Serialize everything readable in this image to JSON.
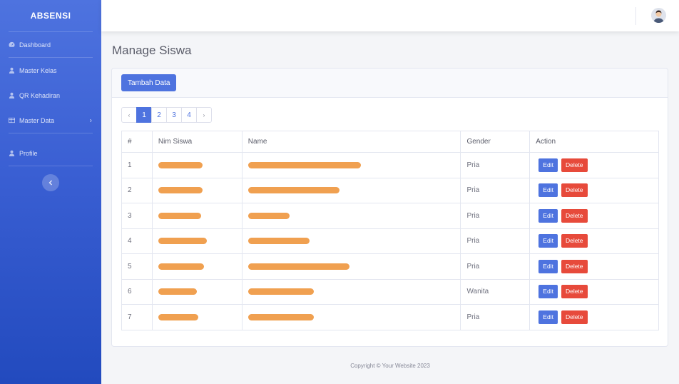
{
  "sidebar": {
    "brand": "ABSENSI",
    "items": [
      {
        "label": "Dashboard",
        "icon": "dashboard-icon"
      },
      {
        "label": "Master Kelas",
        "icon": "user-icon"
      },
      {
        "label": "QR Kehadiran",
        "icon": "user-icon"
      },
      {
        "label": "Master Data",
        "icon": "table-icon",
        "chevron": "›"
      },
      {
        "label": "Profile",
        "icon": "user-icon"
      }
    ],
    "toggle_icon": "chevron-left-icon"
  },
  "topbar": {
    "avatar_icon": "user-avatar-icon"
  },
  "page": {
    "title": "Manage Siswa"
  },
  "card": {
    "add_button": "Tambah Data",
    "pagination": {
      "prev": "‹",
      "pages": [
        "1",
        "2",
        "3",
        "4"
      ],
      "active": "1",
      "next": "›"
    },
    "table": {
      "headers": [
        "#",
        "Nim Siswa",
        "Name",
        "Gender",
        "Action"
      ],
      "rows": [
        {
          "no": "1",
          "gender": "Pria"
        },
        {
          "no": "2",
          "gender": "Pria"
        },
        {
          "no": "3",
          "gender": "Pria"
        },
        {
          "no": "4",
          "gender": "Pria"
        },
        {
          "no": "5",
          "gender": "Pria"
        },
        {
          "no": "6",
          "gender": "Wanita"
        },
        {
          "no": "7",
          "gender": "Pria"
        }
      ],
      "edit_label": "Edit",
      "delete_label": "Delete"
    }
  },
  "footer": {
    "copyright": "Copyright © Your Website 2023"
  },
  "colors": {
    "primary": "#4e73df",
    "danger": "#e74a3b",
    "redaction": "#f0a050"
  }
}
